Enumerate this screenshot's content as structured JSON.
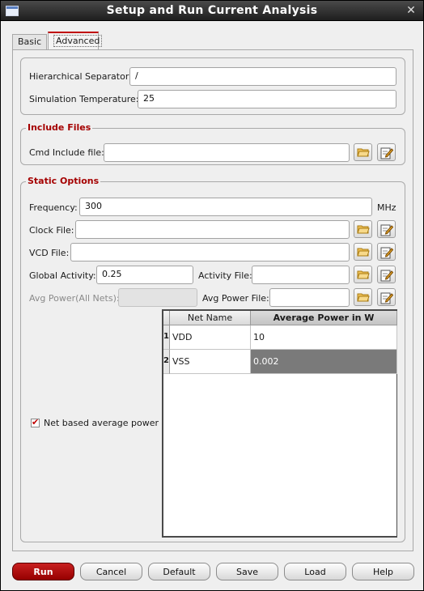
{
  "window": {
    "title": "Setup and Run Current Analysis",
    "close_glyph": "✕"
  },
  "tabs": [
    {
      "label": "Basic"
    },
    {
      "label": "Advanced"
    }
  ],
  "general": {
    "hier_sep_label": "Hierarchical Separator:",
    "hier_sep_value": "/",
    "sim_temp_label": "Simulation Temperature:",
    "sim_temp_value": "25"
  },
  "include_files": {
    "title": "Include Files",
    "cmd_label": "Cmd Include file:",
    "cmd_value": ""
  },
  "static_options": {
    "title": "Static Options",
    "frequency_label": "Frequency:",
    "frequency_value": "300",
    "frequency_unit": "MHz",
    "clock_label": "Clock File:",
    "clock_value": "",
    "vcd_label": "VCD File:",
    "vcd_value": "",
    "global_activity_label": "Global Activity:",
    "global_activity_value": "0.25",
    "activity_file_label": "Activity File:",
    "activity_file_value": "",
    "avg_power_all_label": "Avg Power(All Nets):",
    "avg_power_all_value": "",
    "avg_power_file_label": "Avg Power File:",
    "avg_power_file_value": ""
  },
  "net_table": {
    "headers": [
      "Net Name",
      "Average Power in W"
    ],
    "rows": [
      {
        "num": "1",
        "net": "VDD",
        "power": "10"
      },
      {
        "num": "2",
        "net": "VSS",
        "power": "0.002"
      }
    ]
  },
  "net_based": {
    "label": "Net based average power",
    "checked": true
  },
  "buttons": {
    "run": "Run",
    "cancel": "Cancel",
    "default": "Default",
    "save": "Save",
    "load": "Load",
    "help": "Help"
  },
  "colors": {
    "accent": "#a50000",
    "run_button": "#b81414",
    "selected_row": "#7a7a7a"
  },
  "icons": [
    "folder-open-icon",
    "edit-file-icon",
    "checkmark-icon",
    "window-icon",
    "close-icon"
  ]
}
